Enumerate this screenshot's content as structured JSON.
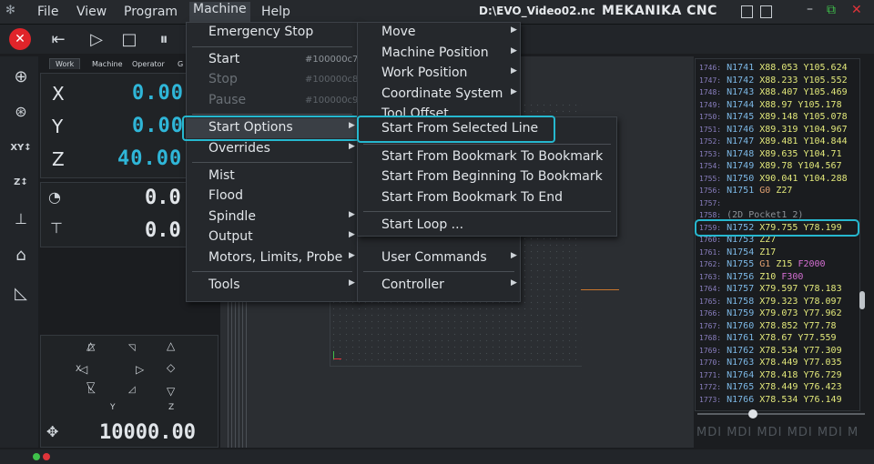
{
  "menubar": {
    "items": [
      "File",
      "View",
      "Program",
      "Machine",
      "Help"
    ],
    "file_path": "D:\\EVO_Video02.nc",
    "brand": "MEKANIKA CNC"
  },
  "dro": {
    "tabs": [
      "Work",
      "Machine",
      "Operator",
      "G"
    ],
    "axes": [
      {
        "label": "X",
        "value": "0.00"
      },
      {
        "label": "Y",
        "value": "0.00"
      },
      {
        "label": "Z",
        "value": "40.00"
      }
    ],
    "feed_value": "0.0",
    "spindle_value": "0.0",
    "jog_step": "10000.00",
    "jog_labels": {
      "x": "X",
      "y": "Y",
      "z": "Z"
    }
  },
  "machine_menu": {
    "items": [
      {
        "label": "Emergency Stop",
        "shortcut": "",
        "arrow": false,
        "disabled": false
      },
      {
        "label": "Start",
        "shortcut": "#100000c7",
        "arrow": false,
        "disabled": false
      },
      {
        "label": "Stop",
        "shortcut": "#100000c8",
        "arrow": false,
        "disabled": true
      },
      {
        "label": "Pause",
        "shortcut": "#100000c9",
        "arrow": false,
        "disabled": true
      },
      {
        "label": "Start Options",
        "shortcut": "",
        "arrow": true,
        "disabled": false
      },
      {
        "label": "Overrides",
        "shortcut": "",
        "arrow": true,
        "disabled": false
      },
      {
        "label": "Mist",
        "shortcut": "",
        "arrow": false,
        "disabled": false
      },
      {
        "label": "Flood",
        "shortcut": "",
        "arrow": false,
        "disabled": false
      },
      {
        "label": "Spindle",
        "shortcut": "",
        "arrow": true,
        "disabled": false
      },
      {
        "label": "Output",
        "shortcut": "",
        "arrow": true,
        "disabled": false
      },
      {
        "label": "Motors, Limits, Probe",
        "shortcut": "",
        "arrow": true,
        "disabled": false
      },
      {
        "label": "Tools",
        "shortcut": "",
        "arrow": true,
        "disabled": false
      }
    ]
  },
  "program_menu": {
    "items": [
      {
        "label": "Move"
      },
      {
        "label": "Machine Position"
      },
      {
        "label": "Work Position"
      },
      {
        "label": "Coordinate System"
      },
      {
        "label": "Tool Offset"
      },
      {
        "label": "User Commands"
      },
      {
        "label": "Controller"
      }
    ]
  },
  "start_options_menu": {
    "items": [
      {
        "label": "Start From Selected Line"
      },
      {
        "label": "Start From Bookmark To Bookmark"
      },
      {
        "label": "Start From Beginning To Bookmark"
      },
      {
        "label": "Start From Bookmark To End"
      },
      {
        "label": "Start Loop ..."
      }
    ]
  },
  "gcode": {
    "lines": [
      {
        "ln": "1746:",
        "n": "N1741",
        "x": "X88.053",
        "y": "Y105.624"
      },
      {
        "ln": "1747:",
        "n": "N1742",
        "x": "X88.233",
        "y": "Y105.552"
      },
      {
        "ln": "1748:",
        "n": "N1743",
        "x": "X88.407",
        "y": "Y105.469"
      },
      {
        "ln": "1749:",
        "n": "N1744",
        "x": "X88.97",
        "y": "Y105.178"
      },
      {
        "ln": "1750:",
        "n": "N1745",
        "x": "X89.148",
        "y": "Y105.078"
      },
      {
        "ln": "1751:",
        "n": "N1746",
        "x": "X89.319",
        "y": "Y104.967"
      },
      {
        "ln": "1752:",
        "n": "N1747",
        "x": "X89.481",
        "y": "Y104.844"
      },
      {
        "ln": "1753:",
        "n": "N1748",
        "x": "X89.635",
        "y": "Y104.71"
      },
      {
        "ln": "1754:",
        "n": "N1749",
        "x": "X89.78",
        "y": "Y104.567"
      },
      {
        "ln": "1755:",
        "n": "N1750",
        "x": "X90.041",
        "y": "Y104.288"
      },
      {
        "ln": "1756:",
        "n": "N1751",
        "g": "G0",
        "x": "Z27"
      },
      {
        "ln": "1757:"
      },
      {
        "ln": "1758:",
        "cm": "(2D Pocket1 2)"
      },
      {
        "ln": "1759:",
        "n": "N1752",
        "x": "X79.755",
        "y": "Y78.199"
      },
      {
        "ln": "1760:",
        "n": "N1753",
        "x": "Z27"
      },
      {
        "ln": "1761:",
        "n": "N1754",
        "x": "Z17"
      },
      {
        "ln": "1762:",
        "n": "N1755",
        "g": "G1",
        "x": "Z15",
        "f": "F2000"
      },
      {
        "ln": "1763:",
        "n": "N1756",
        "x": "Z10",
        "f": "F300"
      },
      {
        "ln": "1764:",
        "n": "N1757",
        "x": "X79.597",
        "y": "Y78.183"
      },
      {
        "ln": "1765:",
        "n": "N1758",
        "x": "X79.323",
        "y": "Y78.097"
      },
      {
        "ln": "1766:",
        "n": "N1759",
        "x": "X79.073",
        "y": "Y77.962"
      },
      {
        "ln": "1767:",
        "n": "N1760",
        "x": "X78.852",
        "y": "Y77.78"
      },
      {
        "ln": "1768:",
        "n": "N1761",
        "x": "X78.67",
        "y": "Y77.559"
      },
      {
        "ln": "1769:",
        "n": "N1762",
        "x": "X78.534",
        "y": "Y77.309"
      },
      {
        "ln": "1770:",
        "n": "N1763",
        "x": "X78.449",
        "y": "Y77.035"
      },
      {
        "ln": "1771:",
        "n": "N1764",
        "x": "X78.418",
        "y": "Y76.729"
      },
      {
        "ln": "1772:",
        "n": "N1765",
        "x": "X78.449",
        "y": "Y76.423"
      },
      {
        "ln": "1773:",
        "n": "N1766",
        "x": "X78.534",
        "y": "Y76.149"
      }
    ],
    "selected_index": 13
  },
  "mdi_tabs": [
    "MDI",
    "MDI",
    "MDI",
    "MDI",
    "MDI",
    "M"
  ],
  "colors": {
    "accent": "#26b8cf",
    "estop": "#e0242a",
    "axis_value": "#2fb6d8"
  }
}
